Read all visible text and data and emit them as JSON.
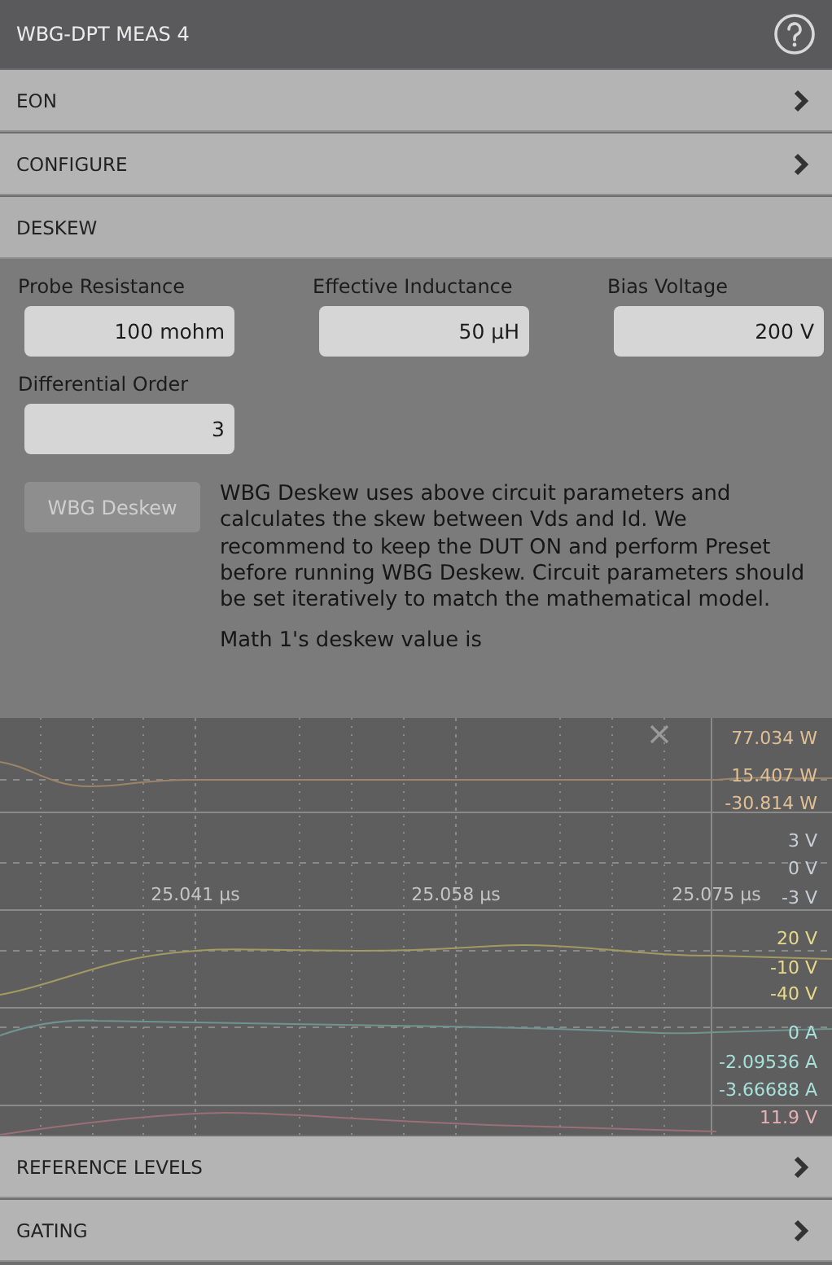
{
  "panel": {
    "title": "WBG-DPT MEAS 4"
  },
  "sections": [
    {
      "label": "EON",
      "expanded": false
    },
    {
      "label": "CONFIGURE",
      "expanded": false
    },
    {
      "label": "DESKEW",
      "expanded": true
    }
  ],
  "deskew": {
    "fields": [
      {
        "label": "Probe Resistance",
        "value": "100 mohm"
      },
      {
        "label": "Effective Inductance",
        "value": "50 µH"
      },
      {
        "label": "Bias Voltage",
        "value": "200 V"
      },
      {
        "label": "Differential Order",
        "value": "3"
      }
    ],
    "button": {
      "label": "WBG Deskew",
      "disabled": true
    },
    "description": "WBG Deskew uses above circuit parameters and calculates the skew between Vds and Id. We recommend to keep the DUT ON and perform Preset before running WBG Deskew. Circuit parameters should be set iteratively to match the mathematical model.",
    "result": "Math 1's deskew value is"
  },
  "scope": {
    "time_labels": [
      "25.041 µs",
      "25.058 µs",
      "25.075 µs"
    ],
    "readouts": [
      {
        "text": "77.034 W",
        "color": "#e0bf94"
      },
      {
        "text": "15.407 W",
        "color": "#e0bf94"
      },
      {
        "text": "-30.814 W",
        "color": "#e0bf94"
      },
      {
        "text": "3 V",
        "color": "#c8ced6"
      },
      {
        "text": "0 V",
        "color": "#c8ced6"
      },
      {
        "text": "-3 V",
        "color": "#c8ced6"
      },
      {
        "text": "20 V",
        "color": "#e6da8a"
      },
      {
        "text": "-10 V",
        "color": "#e6da8a"
      },
      {
        "text": "-40 V",
        "color": "#e6da8a"
      },
      {
        "text": "0 A",
        "color": "#a8e0da"
      },
      {
        "text": "-2.09536 A",
        "color": "#a8e0da"
      },
      {
        "text": "-3.66688 A",
        "color": "#a8e0da"
      },
      {
        "text": "11.9 V",
        "color": "#eab0b8"
      }
    ]
  },
  "bottom_sections": [
    {
      "label": "REFERENCE LEVELS",
      "expanded": false
    },
    {
      "label": "GATING",
      "expanded": false
    }
  ]
}
